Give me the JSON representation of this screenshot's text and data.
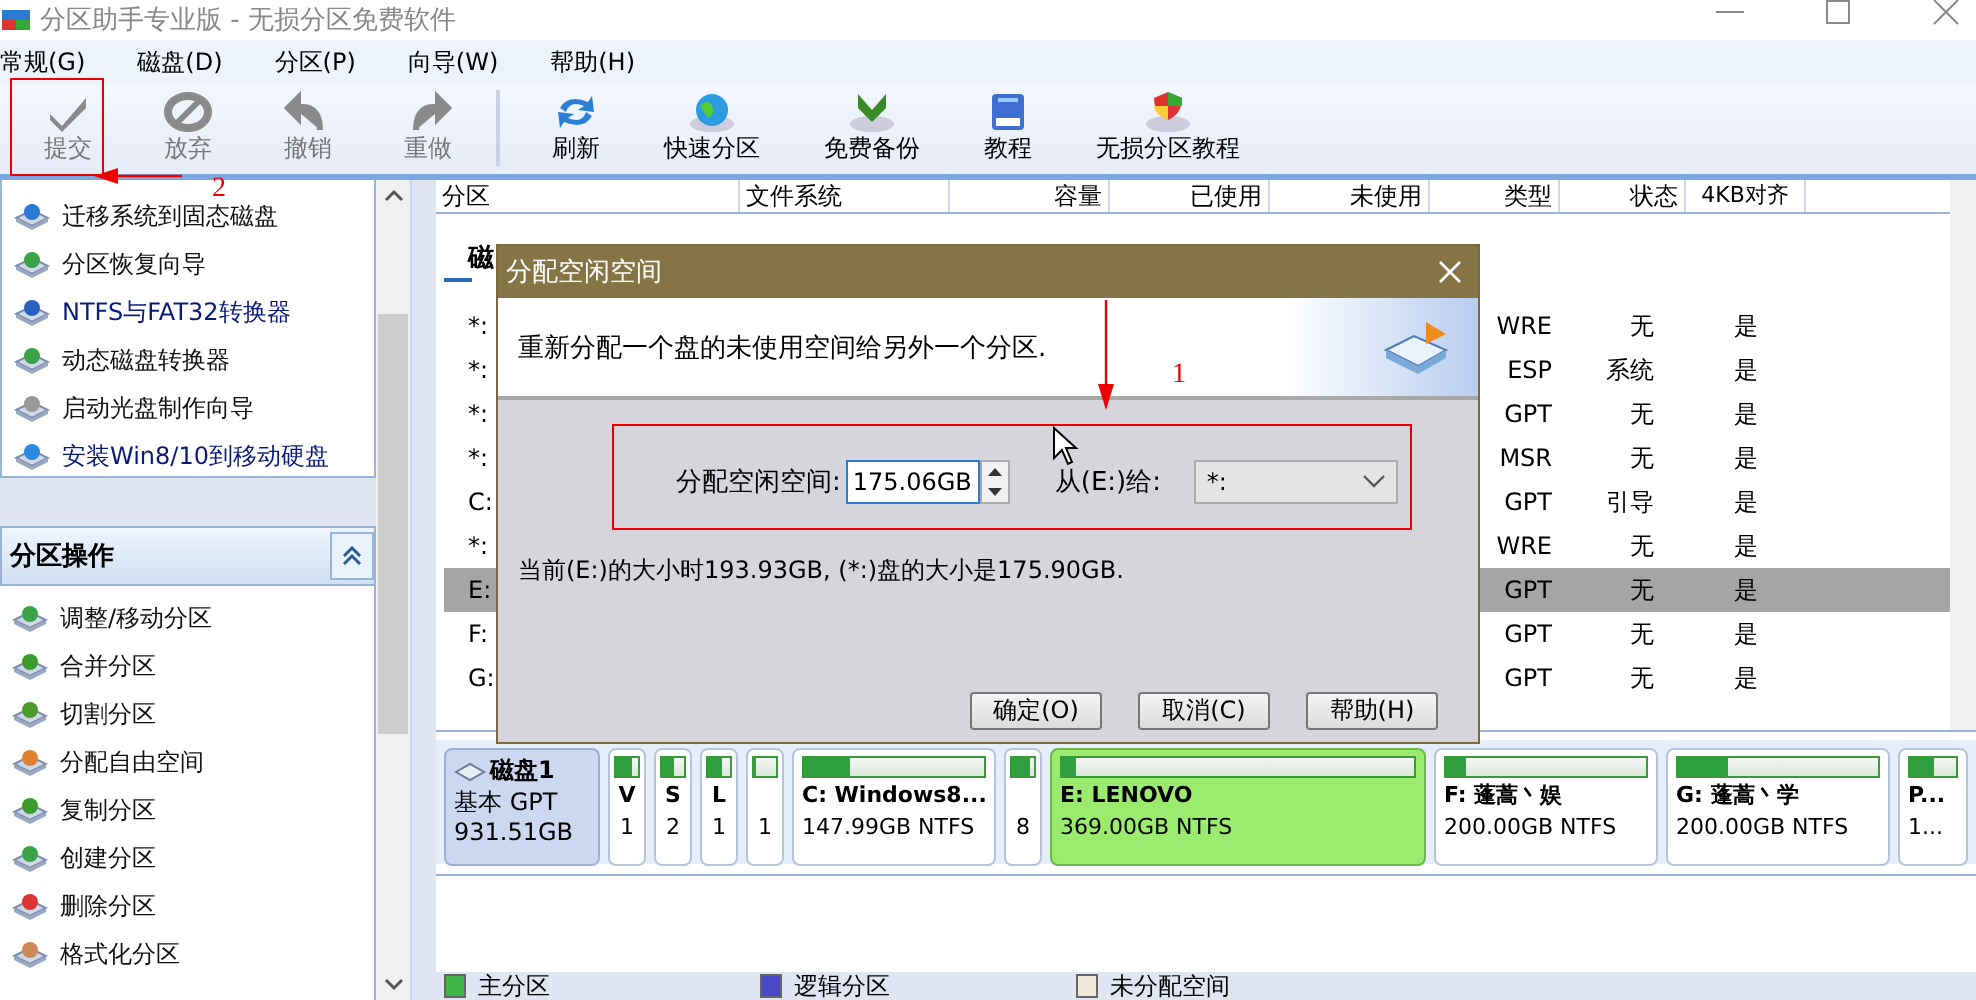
{
  "window": {
    "title": "分区助手专业版 - 无损分区免费软件"
  },
  "menu": [
    "常规(G)",
    "磁盘(D)",
    "分区(P)",
    "向导(W)",
    "帮助(H)"
  ],
  "toolbar": {
    "edit_buttons": [
      {
        "label": "提交",
        "kind": "check",
        "disabled": true
      },
      {
        "label": "放弃",
        "kind": "discard",
        "disabled": true
      },
      {
        "label": "撤销",
        "kind": "undo",
        "disabled": true
      },
      {
        "label": "重做",
        "kind": "redo",
        "disabled": true
      }
    ],
    "tool_buttons": [
      {
        "label": "刷新",
        "kind": "refresh",
        "disabled": false
      },
      {
        "label": "快速分区",
        "kind": "globe",
        "disabled": false
      },
      {
        "label": "免费备份",
        "kind": "backup",
        "disabled": false
      },
      {
        "label": "教程",
        "kind": "book",
        "disabled": false
      },
      {
        "label": "无损分区教程",
        "kind": "shield",
        "disabled": false
      }
    ]
  },
  "sidebar": {
    "wizards": [
      "迁移系统到固态磁盘",
      "分区恢复向导",
      "NTFS与FAT32转换器",
      "动态磁盘转换器",
      "启动光盘制作向导",
      "安装Win8/10到移动硬盘"
    ],
    "partition_ops": {
      "title": "分区操作",
      "expanded": true,
      "items": [
        "调整/移动分区",
        "合并分区",
        "切割分区",
        "分配自由空间",
        "复制分区",
        "创建分区",
        "删除分区",
        "格式化分区"
      ]
    }
  },
  "table": {
    "columns": [
      "分区",
      "文件系统",
      "容量",
      "已使用",
      "未使用",
      "类型",
      "状态",
      "4KB对齐"
    ],
    "disk_heading": "磁",
    "rows": [
      {
        "partition": "*:",
        "type": "WRE",
        "status": "无",
        "aligned": "是",
        "selected": false
      },
      {
        "partition": "*:",
        "type": "ESP",
        "status": "系统",
        "aligned": "是",
        "selected": false
      },
      {
        "partition": "*:",
        "type": "GPT",
        "status": "无",
        "aligned": "是",
        "selected": false
      },
      {
        "partition": "*:",
        "type": "MSR",
        "status": "无",
        "aligned": "是",
        "selected": false
      },
      {
        "partition": "C:",
        "type": "GPT",
        "status": "引导",
        "aligned": "是",
        "selected": false
      },
      {
        "partition": "*:",
        "type": "WRE",
        "status": "无",
        "aligned": "是",
        "selected": false
      },
      {
        "partition": "E:",
        "type": "GPT",
        "status": "无",
        "aligned": "是",
        "selected": true
      },
      {
        "partition": "F:",
        "type": "GPT",
        "status": "无",
        "aligned": "是",
        "selected": false
      },
      {
        "partition": "G:",
        "type": "GPT",
        "status": "无",
        "aligned": "是",
        "selected": false
      }
    ]
  },
  "disk_map": {
    "disk": {
      "name": "磁盘1",
      "type": "基本 GPT",
      "size": "931.51GB"
    },
    "partitions": [
      {
        "kind": "small",
        "label": "V",
        "detail": "1",
        "level": 0.7,
        "selected": false
      },
      {
        "kind": "small",
        "label": "S",
        "detail": "2",
        "level": 0.5,
        "selected": false
      },
      {
        "kind": "small",
        "label": "L",
        "detail": "1",
        "level": 0.6,
        "selected": false
      },
      {
        "kind": "small",
        "detail": "1",
        "level": 0.1,
        "selected": false
      },
      {
        "kind": "medium",
        "label": "C: Windows8...",
        "detail": "147.99GB NTFS",
        "level": 0.25,
        "selected": false
      },
      {
        "kind": "small",
        "detail": "8",
        "level": 0.8,
        "selected": false
      },
      {
        "kind": "wide",
        "label": "E: LENOVO",
        "detail": "369.00GB NTFS",
        "level": 0.04,
        "selected": true
      },
      {
        "kind": "medium",
        "label": "F: 蓬蒿丶娱",
        "detail": "200.00GB NTFS",
        "level": 0.1,
        "selected": false
      },
      {
        "kind": "medium",
        "label": "G: 蓬蒿丶学",
        "detail": "200.00GB NTFS",
        "level": 0.25,
        "selected": false
      },
      {
        "kind": "partial",
        "label": "P...",
        "detail": "1...",
        "level": 0.5,
        "selected": false
      }
    ]
  },
  "legend": [
    {
      "label": "主分区",
      "color": "#3fb54a"
    },
    {
      "label": "逻辑分区",
      "color": "#4848c8"
    },
    {
      "label": "未分配空间",
      "color": "#f0e8d8"
    }
  ],
  "dialog": {
    "title": "分配空闲空间",
    "description": "重新分配一个盘的未使用空间给另外一个分区.",
    "size_label": "分配空闲空间:",
    "size_value": "175.06GB",
    "from_label": "从(E:)给:",
    "from_value": "*:",
    "info": "当前(E:)的大小时193.93GB, (*:)盘的大小是175.90GB.",
    "buttons": [
      "确定(O)",
      "取消(C)",
      "帮助(H)"
    ]
  },
  "annotations": [
    {
      "text": "1"
    },
    {
      "text": "2"
    }
  ]
}
